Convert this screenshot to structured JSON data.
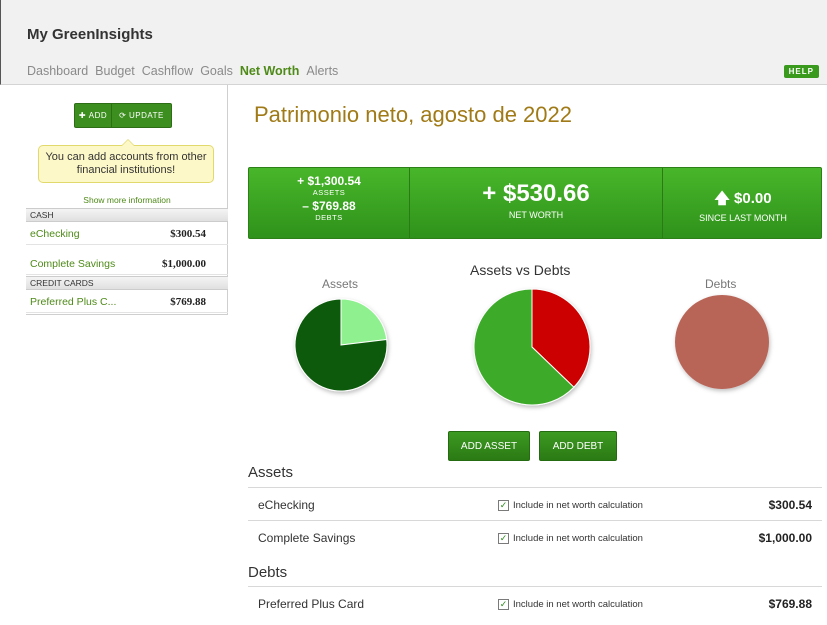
{
  "header": {
    "app_title": "My GreenInsights",
    "nav": [
      "Dashboard",
      "Budget",
      "Cashflow",
      "Goals",
      "Net Worth",
      "Alerts"
    ],
    "nav_active": "Net Worth",
    "help_label": "HELP"
  },
  "sidebar": {
    "add_label": "ADD",
    "update_label": "UPDATE",
    "tip": "You can add accounts from other financial institutions!",
    "show_more": "Show more information",
    "sections": [
      {
        "title": "CASH",
        "accounts": [
          {
            "name": "eChecking",
            "amount": "$300.54"
          },
          {
            "name": "Complete Savings",
            "amount": "$1,000.00"
          }
        ]
      },
      {
        "title": "CREDIT CARDS",
        "accounts": [
          {
            "name": "Preferred Plus C...",
            "amount": "$769.88"
          }
        ]
      }
    ]
  },
  "main": {
    "title": "Patrimonio neto, agosto de 2022",
    "summary": {
      "assets_value": "+ $1,300.54",
      "assets_label": "ASSETS",
      "debts_value": "– $769.88",
      "debts_label": "DEBTS",
      "net_worth_value": "+ $530.66",
      "net_worth_label": "NET WORTH",
      "change_value": "$0.00",
      "change_label": "SINCE LAST MONTH"
    },
    "charts_title": "Assets vs Debts",
    "assets_pie_label": "Assets",
    "debts_pie_label": "Debts",
    "add_asset_label": "ADD ASSET",
    "add_debt_label": "ADD DEBT",
    "assets_heading": "Assets",
    "debts_heading": "Debts",
    "include_label": "Include in net worth calculation",
    "assets": [
      {
        "name": "eChecking",
        "amount": "$300.54"
      },
      {
        "name": "Complete Savings",
        "amount": "$1,000.00"
      }
    ],
    "debts": [
      {
        "name": "Preferred Plus Card",
        "amount": "$769.88"
      }
    ]
  },
  "chart_data": [
    {
      "type": "pie",
      "title": "Assets",
      "categories": [
        "Complete Savings",
        "eChecking"
      ],
      "values": [
        1000.0,
        300.54
      ],
      "colors": [
        "#0e5a0e",
        "#8ff08f"
      ]
    },
    {
      "type": "pie",
      "title": "Assets vs Debts",
      "categories": [
        "Assets",
        "Debts"
      ],
      "values": [
        1300.54,
        769.88
      ],
      "colors": [
        "#3daa2a",
        "#cc0000"
      ]
    },
    {
      "type": "pie",
      "title": "Debts",
      "categories": [
        "Preferred Plus Card"
      ],
      "values": [
        769.88
      ],
      "colors": [
        "#b86558"
      ]
    }
  ],
  "colors": {
    "brand_green": "#3c8f1f",
    "title_gold": "#a07a16",
    "link_green": "#4e8a18"
  }
}
